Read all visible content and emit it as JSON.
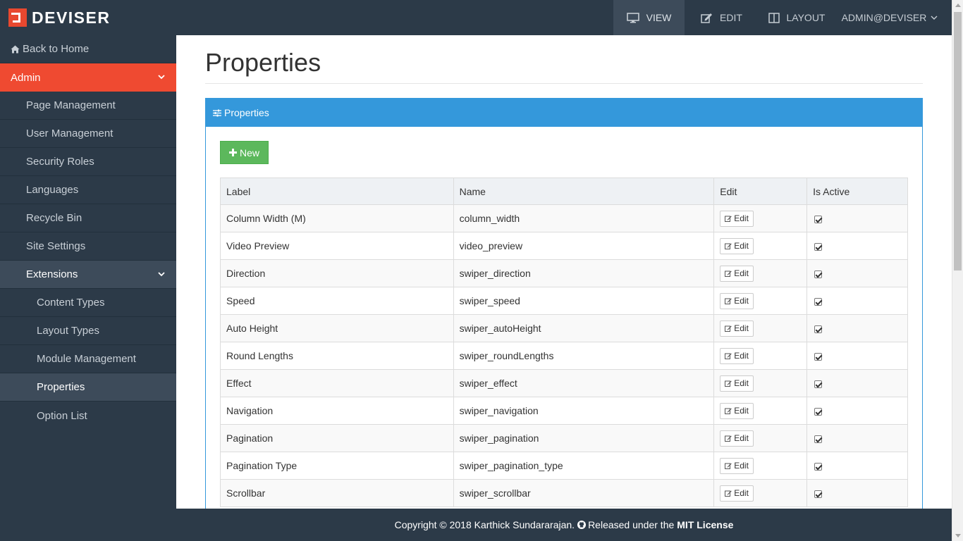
{
  "brand": {
    "name": "DEVISER",
    "accent": "#e8482f"
  },
  "topnav": {
    "view": "VIEW",
    "edit": "EDIT",
    "layout": "LAYOUT",
    "user": "ADMIN@DEVISER"
  },
  "sidebar": {
    "back": "Back to Home",
    "admin": "Admin",
    "items": [
      "Page Management",
      "User Management",
      "Security Roles",
      "Languages",
      "Recycle Bin",
      "Site Settings"
    ],
    "extensions": "Extensions",
    "ext_items": [
      "Content Types",
      "Layout Types",
      "Module Management",
      "Properties",
      "Option List"
    ],
    "active": "Properties"
  },
  "page": {
    "title": "Properties",
    "panel_title": "Properties",
    "new_button": "New"
  },
  "table": {
    "headers": [
      "Label",
      "Name",
      "Edit",
      "Is Active"
    ],
    "edit_label": "Edit",
    "rows": [
      {
        "label": "Column Width (M)",
        "name": "column_width",
        "active": true
      },
      {
        "label": "Video Preview",
        "name": "video_preview",
        "active": true
      },
      {
        "label": "Direction",
        "name": "swiper_direction",
        "active": true
      },
      {
        "label": "Speed",
        "name": "swiper_speed",
        "active": true
      },
      {
        "label": "Auto Height",
        "name": "swiper_autoHeight",
        "active": true
      },
      {
        "label": "Round Lengths",
        "name": "swiper_roundLengths",
        "active": true
      },
      {
        "label": "Effect",
        "name": "swiper_effect",
        "active": true
      },
      {
        "label": "Navigation",
        "name": "swiper_navigation",
        "active": true
      },
      {
        "label": "Pagination",
        "name": "swiper_pagination",
        "active": true
      },
      {
        "label": "Pagination Type",
        "name": "swiper_pagination_type",
        "active": true
      },
      {
        "label": "Scrollbar",
        "name": "swiper_scrollbar",
        "active": true
      }
    ]
  },
  "footer": {
    "copyright": "Copyright © 2018 Karthick Sundararajan.",
    "released": "Released under the",
    "license": "MIT License"
  },
  "colors": {
    "nav_bg": "#2c3a48",
    "nav_active": "#3d4b5a",
    "admin_red": "#ef4a31",
    "panel_blue": "#3498db",
    "new_green": "#5cb85c"
  }
}
